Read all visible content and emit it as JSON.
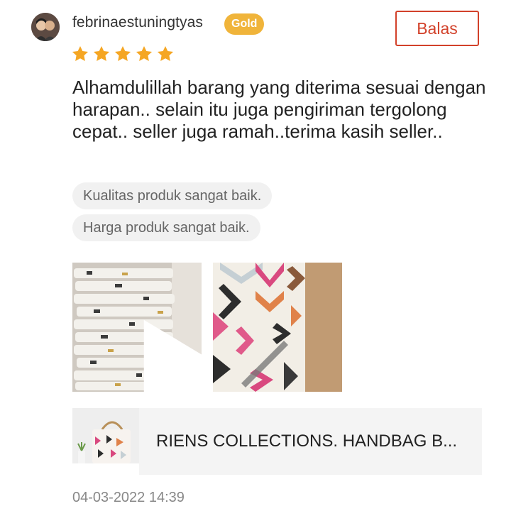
{
  "review": {
    "username": "febrinaestuningtyas",
    "badge": "Gold",
    "reply_label": "Balas",
    "rating": 5,
    "rating_max": 5,
    "text": "Alhamdulillah barang yang diterima sesuai dengan harapan.. selain itu juga pengiriman tergolong cepat.. seller juga ramah..terima kasih seller..",
    "tags": [
      "Kualitas produk sangat baik.",
      "Harga produk sangat baik."
    ],
    "media": [
      {
        "type": "video",
        "icon": "play-icon"
      },
      {
        "type": "image"
      }
    ],
    "product_name": "RIENS COLLECTIONS. HANDBAG B...",
    "timestamp": "04-03-2022 14:39"
  },
  "colors": {
    "accent": "#d2412a",
    "badge": "#f0b43a",
    "star": "#f5a623",
    "tag_bg": "#f1f1f1",
    "muted": "#888888"
  }
}
